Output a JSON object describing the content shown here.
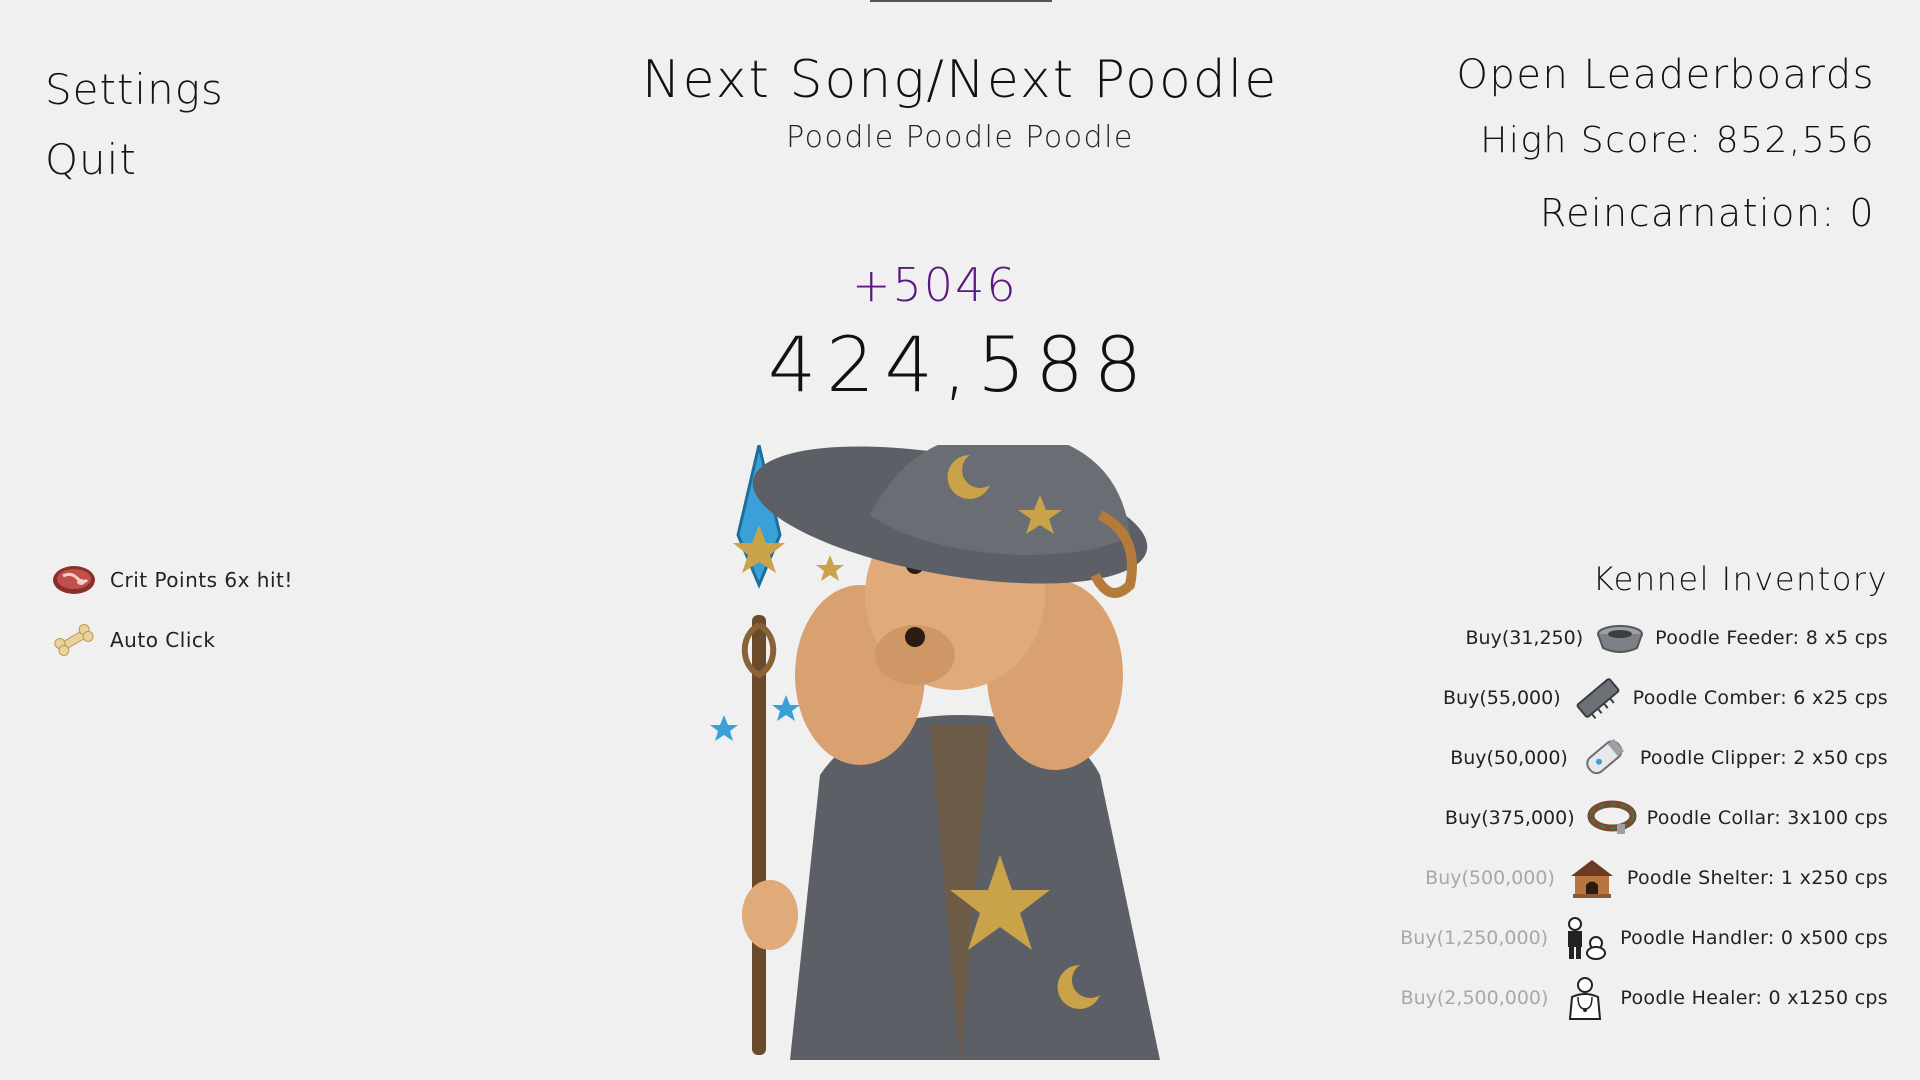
{
  "menu": {
    "settings": "Settings",
    "quit": "Quit"
  },
  "song": {
    "title": "Next Song/Next Poodle",
    "subtitle": "Poodle Poodle Poodle"
  },
  "stats": {
    "leaderboards": "Open Leaderboards",
    "high_score": "High Score: 852,556",
    "reincarnation": "Reincarnation: 0"
  },
  "score": {
    "gain": "+5046",
    "total": "424,588"
  },
  "status": [
    {
      "icon": "steak-icon",
      "label": "Crit Points 6x hit!"
    },
    {
      "icon": "bone-icon",
      "label": "Auto Click"
    }
  ],
  "inventory": {
    "title": "Kennel Inventory",
    "items": [
      {
        "buy": "Buy(31,250)",
        "label": "Poodle Feeder: 8 x5 cps",
        "icon": "feeder-bowl-icon",
        "affordable": true
      },
      {
        "buy": "Buy(55,000)",
        "label": "Poodle Comber: 6 x25 cps",
        "icon": "comb-icon",
        "affordable": true
      },
      {
        "buy": "Buy(50,000)",
        "label": "Poodle Clipper: 2 x50 cps",
        "icon": "clipper-icon",
        "affordable": true
      },
      {
        "buy": "Buy(375,000)",
        "label": "Poodle Collar: 3x100 cps",
        "icon": "collar-icon",
        "affordable": true
      },
      {
        "buy": "Buy(500,000)",
        "label": "Poodle Shelter: 1 x250 cps",
        "icon": "doghouse-icon",
        "affordable": false
      },
      {
        "buy": "Buy(1,250,000)",
        "label": "Poodle Handler: 0 x500 cps",
        "icon": "handler-icon",
        "affordable": false
      },
      {
        "buy": "Buy(2,500,000)",
        "label": "Poodle Healer: 0 x1250 cps",
        "icon": "healer-icon",
        "affordable": false
      }
    ]
  },
  "colors": {
    "background": "#f0f0f0",
    "gain": "#5b1680",
    "disabled_buy": "#a8a8a8"
  }
}
